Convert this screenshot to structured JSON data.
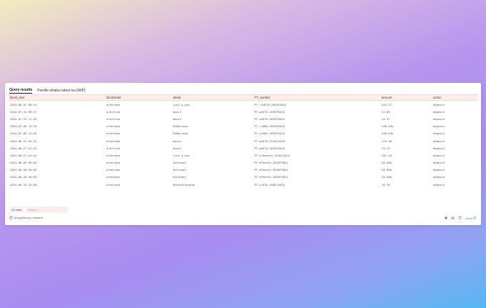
{
  "tabs": [
    {
      "label": "Query results",
      "active": true
    },
    {
      "label": "Pendle whales latest txs [WIP]",
      "active": false
    }
  ],
  "table": {
    "columns": [
      "block_time",
      "blockchain",
      "whale",
      "PT_symbol",
      "amount",
      "action"
    ],
    "rows": [
      [
        "2024-08-01 09:24",
        "ethereum",
        "just_a_guy",
        "PT-rswETH-26SEP2024",
        "253.17",
        "deposit"
      ],
      [
        "2024-07-31 09:27",
        "arbitrum",
        "mozzz",
        "PT-weETH-26SEP2024",
        "22.89",
        "deposit"
      ],
      [
        "2024-07-23 11:33",
        "arbitrum",
        "mozzz",
        "PT-weETH-26SEP2024",
        "14.37",
        "deposit"
      ],
      [
        "2024-07-09 12:34",
        "ethereum",
        "RiWalings",
        "PT-rsENA-26SEP2024",
        "136.53k",
        "deposit"
      ],
      [
        "2024-07-09 12:20",
        "ethereum",
        "RiWalings",
        "PT-sUSDE-26SEP2024",
        "536.64k",
        "deposit"
      ],
      [
        "2024-06-27 01:31",
        "ethereum",
        "mozzz",
        "PT-weETH-25JUL2024",
        "174.40",
        "deposit"
      ],
      [
        "2024-06-27 01:25",
        "arbitrum",
        "mozzz",
        "PT-weETH-26SEP2024",
        "74.25",
        "deposit"
      ],
      [
        "2024-06-27 01:01",
        "ethereum",
        "just_a_guy",
        "PT-ezRsweth-25JUL2024",
        "391.44",
        "deposit"
      ],
      [
        "2024-06-26 09:03",
        "ethereum",
        "holonaut",
        "PT-ePendle-26SEP2024",
        "20.00k",
        "deposit"
      ],
      [
        "2024-06-26 09:03",
        "ethereum",
        "holonaut",
        "PT-ePendle-26SEP2024",
        "20.00k",
        "deposit"
      ],
      [
        "2024-06-26 09:03",
        "ethereum",
        "holonaut",
        "PT-ePendle-26SEP2024",
        "20.00k",
        "deposit"
      ],
      [
        "2024-05-10 23:30",
        "ethereum",
        "HonestFarming",
        "PT-stETH-25DEC2025",
        "16.70",
        "deposit"
      ]
    ]
  },
  "footer": {
    "row_count": "12 rows",
    "search_placeholder": "Search..."
  },
  "author": {
    "handle": "@cryptokoryo_research",
    "icon": "user-circle-icon"
  },
  "actions": {
    "time_ago": "11hrs",
    "icons": [
      "lock-icon",
      "camera-icon",
      "refresh-icon",
      "clock-icon"
    ]
  }
}
